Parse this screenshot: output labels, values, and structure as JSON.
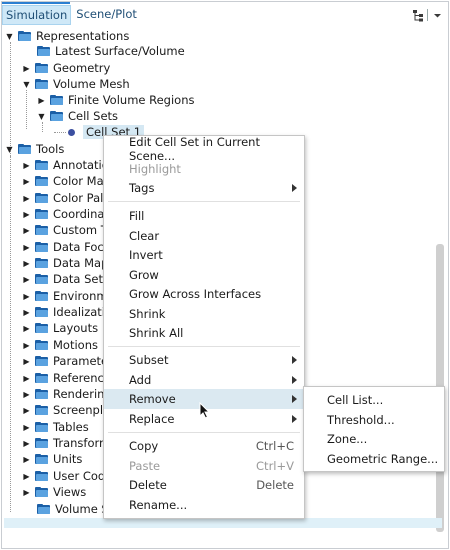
{
  "tabs": [
    {
      "label": "Simulation",
      "active": true
    },
    {
      "label": "Scene/Plot",
      "active": false
    }
  ],
  "toolbar_icons": [
    "tree-layout-icon",
    "chevron-down-icon"
  ],
  "tree": {
    "representations": {
      "label": "Representations",
      "children": [
        "Latest Surface/Volume",
        "Geometry",
        "Volume Mesh"
      ],
      "volume_mesh_children": [
        "Finite Volume Regions",
        "Cell Sets"
      ],
      "cell_sets_children": [
        "Cell Set 1"
      ]
    },
    "tools": {
      "label": "Tools",
      "children": [
        "Annotatio",
        "Color Map",
        "Color Pale",
        "Coordinat",
        "Custom T",
        "Data Focu",
        "Data Map",
        "Data Set F",
        "Environm",
        "Idealizati",
        "Layouts",
        "Motions",
        "Paramete",
        "Reference",
        "Rendering",
        "Screenplay",
        "Tables",
        "Transform",
        "Units",
        "User Code",
        "Views",
        "Volume Sh"
      ]
    }
  },
  "context_menu": {
    "items": [
      {
        "label": "Edit Cell Set in Current Scene...",
        "shortcut": "",
        "submenu": false,
        "disabled": false
      },
      {
        "label": "Highlight",
        "shortcut": "",
        "submenu": false,
        "disabled": true
      },
      {
        "label": "Tags",
        "shortcut": "",
        "submenu": true,
        "disabled": false
      },
      {
        "label": "Fill",
        "shortcut": "",
        "submenu": false,
        "disabled": false
      },
      {
        "label": "Clear",
        "shortcut": "",
        "submenu": false,
        "disabled": false
      },
      {
        "label": "Invert",
        "shortcut": "",
        "submenu": false,
        "disabled": false
      },
      {
        "label": "Grow",
        "shortcut": "",
        "submenu": false,
        "disabled": false
      },
      {
        "label": "Grow Across Interfaces",
        "shortcut": "",
        "submenu": false,
        "disabled": false
      },
      {
        "label": "Shrink",
        "shortcut": "",
        "submenu": false,
        "disabled": false
      },
      {
        "label": "Shrink All",
        "shortcut": "",
        "submenu": false,
        "disabled": false
      },
      {
        "label": "Subset",
        "shortcut": "",
        "submenu": true,
        "disabled": false
      },
      {
        "label": "Add",
        "shortcut": "",
        "submenu": true,
        "disabled": false
      },
      {
        "label": "Remove",
        "shortcut": "",
        "submenu": true,
        "disabled": false,
        "hover": true
      },
      {
        "label": "Replace",
        "shortcut": "",
        "submenu": true,
        "disabled": false
      },
      {
        "label": "Copy",
        "shortcut": "Ctrl+C",
        "submenu": false,
        "disabled": false
      },
      {
        "label": "Paste",
        "shortcut": "Ctrl+V",
        "submenu": false,
        "disabled": true
      },
      {
        "label": "Delete",
        "shortcut": "Delete",
        "submenu": false,
        "disabled": false
      },
      {
        "label": "Rename...",
        "shortcut": "",
        "submenu": false,
        "disabled": false
      }
    ]
  },
  "remove_submenu": {
    "items": [
      "Cell List...",
      "Threshold...",
      "Zone...",
      "Geometric Range..."
    ]
  },
  "colors": {
    "accent": "#2d7fd1",
    "selection": "#d5e8f3",
    "menu_hover": "#dbe9f1",
    "folder_dark": "#1b5fa6",
    "folder_light": "#5aa2e0"
  }
}
